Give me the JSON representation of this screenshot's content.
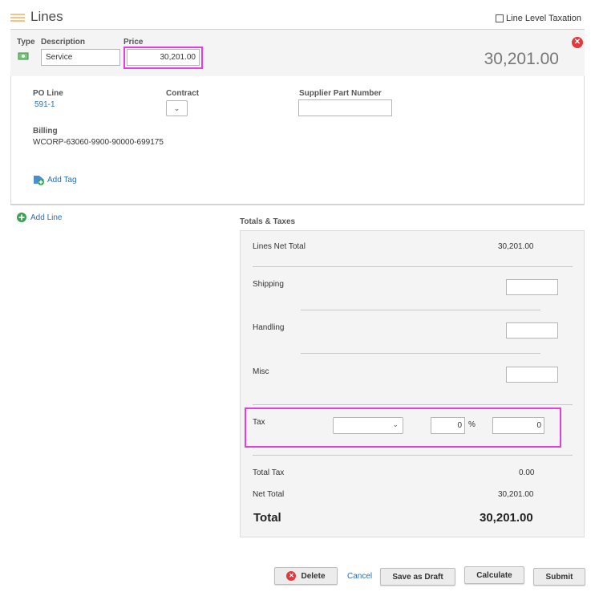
{
  "section": {
    "title": "Lines",
    "line_level_taxation": "Line Level Taxation"
  },
  "line": {
    "headers": {
      "type": "Type",
      "description": "Description",
      "price": "Price"
    },
    "description_value": "Service",
    "price_value": "30,201.00",
    "line_total": "30,201.00",
    "po_line_label": "PO Line",
    "po_line_value": "591-1",
    "contract_label": "Contract",
    "supplier_part_label": "Supplier Part Number",
    "billing_label": "Billing",
    "billing_value": "WCORP-63060-9900-90000-699175",
    "add_tag": "Add Tag"
  },
  "add_line": "Add Line",
  "totals": {
    "title": "Totals & Taxes",
    "lines_net_total_label": "Lines Net Total",
    "lines_net_total_value": "30,201.00",
    "shipping_label": "Shipping",
    "handling_label": "Handling",
    "misc_label": "Misc",
    "tax_label": "Tax",
    "tax_percent_value": "0",
    "tax_percent_sign": "%",
    "tax_amount_value": "0",
    "total_tax_label": "Total Tax",
    "total_tax_value": "0.00",
    "net_total_label": "Net Total",
    "net_total_value": "30,201.00",
    "total_label": "Total",
    "total_value": "30,201.00"
  },
  "actions": {
    "delete": "Delete",
    "cancel": "Cancel",
    "save_as_draft": "Save as Draft",
    "calculate": "Calculate",
    "submit": "Submit"
  },
  "colors": {
    "highlight": "#e040e0",
    "link": "#2a6fb0",
    "delete_icon": "#e0393e",
    "add_icon": "#3aa055"
  }
}
